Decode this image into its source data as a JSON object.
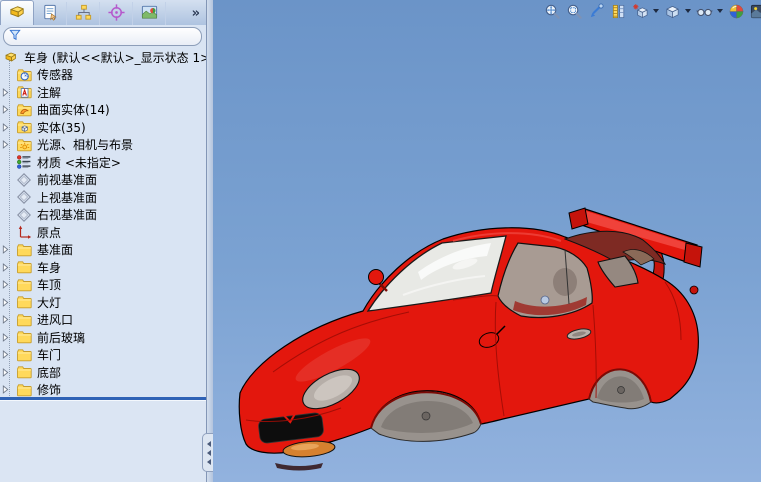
{
  "panel": {
    "tabs": [
      {
        "icon": "feature-manager",
        "active": true
      },
      {
        "icon": "property-manager",
        "active": false
      },
      {
        "icon": "configuration-manager",
        "active": false
      },
      {
        "icon": "dimxpert-manager",
        "active": false
      },
      {
        "icon": "display-manager",
        "active": false
      }
    ],
    "overflow_chevron": "»",
    "filter": {
      "value": ""
    },
    "tree": {
      "root_label": "车身 (默认<<默认>_显示状态 1>",
      "items": [
        {
          "label": "传感器",
          "icon": "sensors",
          "expandable": false
        },
        {
          "label": "注解",
          "icon": "annotations",
          "expandable": true
        },
        {
          "label": "曲面实体(14)",
          "icon": "surface-bodies",
          "expandable": true
        },
        {
          "label": "实体(35)",
          "icon": "solid-bodies",
          "expandable": true
        },
        {
          "label": "光源、相机与布景",
          "icon": "lights-cameras",
          "expandable": true
        },
        {
          "label": "材质 <未指定>",
          "icon": "material",
          "expandable": false
        },
        {
          "label": "前视基准面",
          "icon": "plane",
          "expandable": false
        },
        {
          "label": "上视基准面",
          "icon": "plane",
          "expandable": false
        },
        {
          "label": "右视基准面",
          "icon": "plane",
          "expandable": false
        },
        {
          "label": "原点",
          "icon": "origin",
          "expandable": false
        },
        {
          "label": "基准面",
          "icon": "folder",
          "expandable": true
        },
        {
          "label": "车身",
          "icon": "folder",
          "expandable": true
        },
        {
          "label": "车顶",
          "icon": "folder",
          "expandable": true
        },
        {
          "label": "大灯",
          "icon": "folder",
          "expandable": true
        },
        {
          "label": "进风口",
          "icon": "folder",
          "expandable": true
        },
        {
          "label": "前后玻璃",
          "icon": "folder",
          "expandable": true
        },
        {
          "label": "车门",
          "icon": "folder",
          "expandable": true
        },
        {
          "label": "底部",
          "icon": "folder",
          "expandable": true
        },
        {
          "label": "修饰",
          "icon": "folder",
          "expandable": true
        }
      ]
    }
  },
  "viewport": {
    "toolbar": [
      {
        "icon": "zoom-to-fit",
        "dropdown": false
      },
      {
        "icon": "zoom-to-area",
        "dropdown": false
      },
      {
        "icon": "previous-view",
        "dropdown": false
      },
      {
        "icon": "section-view",
        "dropdown": false
      },
      {
        "icon": "view-orientation",
        "dropdown": true
      },
      {
        "icon": "display-style",
        "dropdown": true
      },
      {
        "icon": "hide-show-items",
        "dropdown": true
      },
      {
        "icon": "edit-appearance",
        "dropdown": false
      },
      {
        "icon": "apply-scene",
        "dropdown": false
      }
    ],
    "colors": {
      "background_top": "#6b94c8",
      "background_bottom": "#92b2de",
      "car_body_red": "#e3170d",
      "glass_gray": "#a89b93",
      "windshield": "#e8e9e5"
    },
    "model_name": "车身"
  }
}
